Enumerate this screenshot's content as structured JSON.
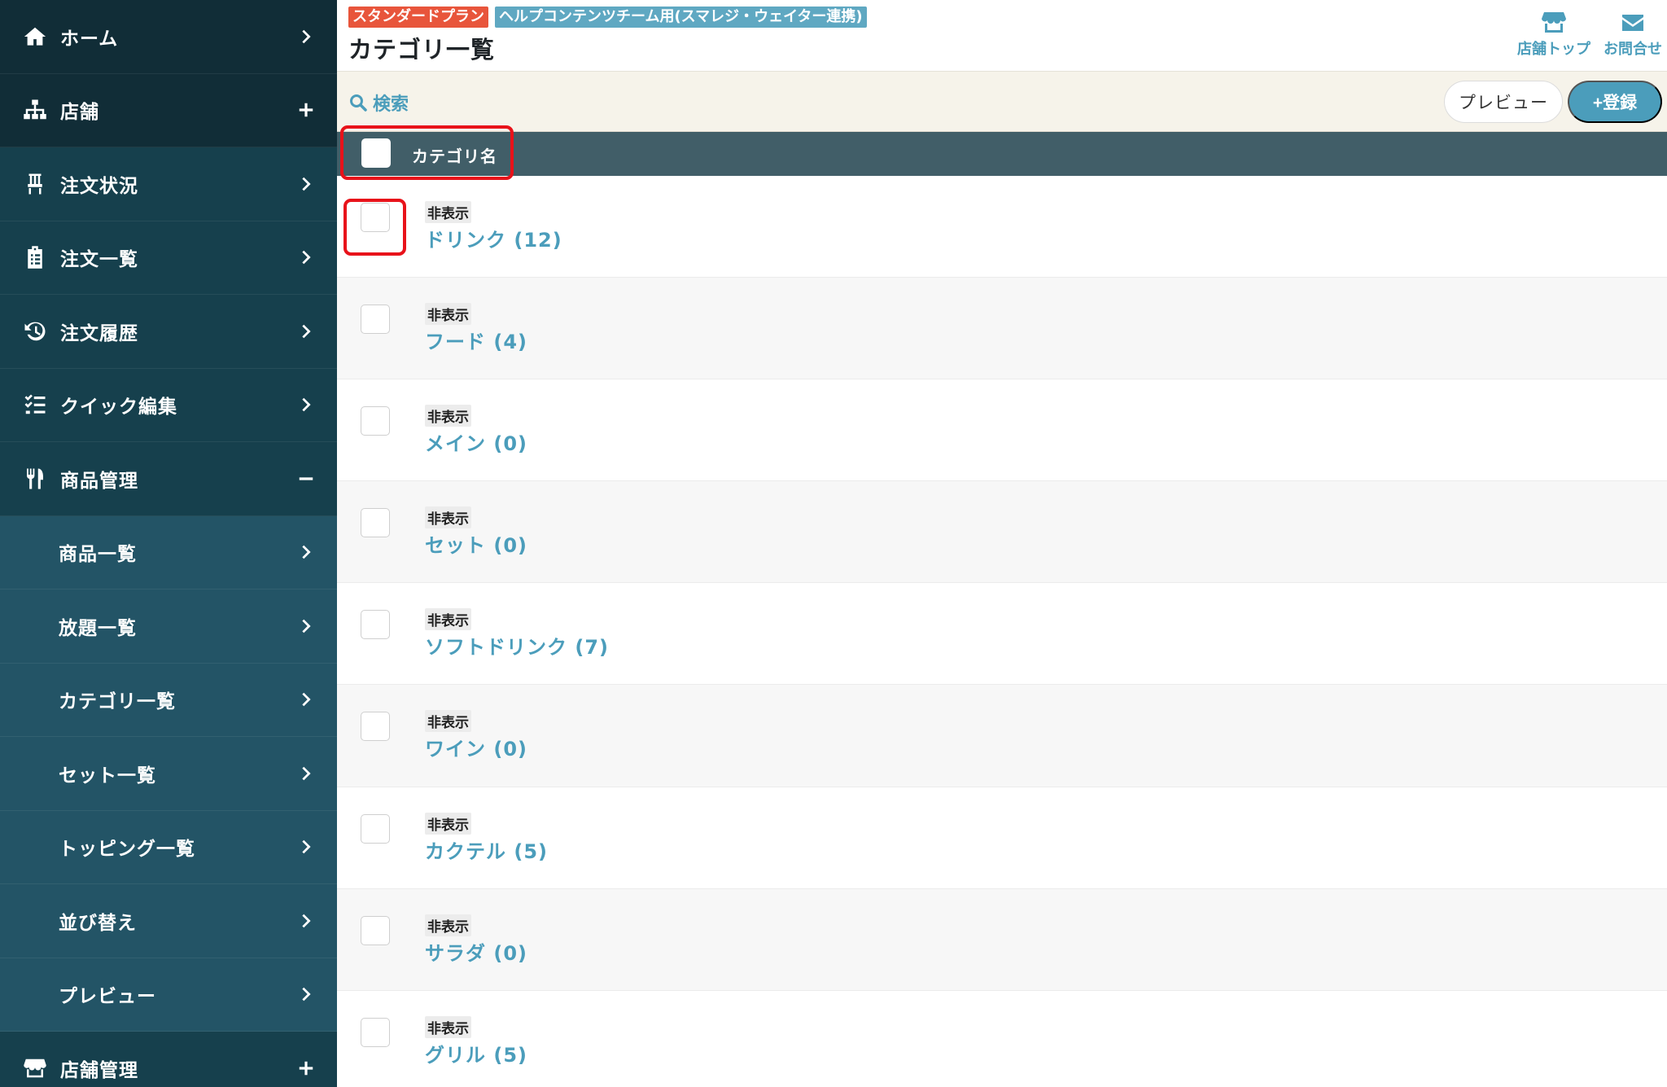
{
  "sidebar": {
    "items": [
      {
        "label": "ホーム",
        "icon": "home-icon",
        "trail": "chevron-right"
      },
      {
        "label": "店舗",
        "icon": "sitemap-icon",
        "trail": "plus"
      },
      {
        "label": "注文状況",
        "icon": "chair-icon",
        "trail": "chevron-right"
      },
      {
        "label": "注文一覧",
        "icon": "clipboard-icon",
        "trail": "chevron-right"
      },
      {
        "label": "注文履歴",
        "icon": "history-icon",
        "trail": "chevron-right"
      },
      {
        "label": "クイック編集",
        "icon": "checklist-icon",
        "trail": "chevron-right"
      },
      {
        "label": "商品管理",
        "icon": "utensils-icon",
        "trail": "minus"
      }
    ],
    "sub_items": [
      {
        "label": "商品一覧"
      },
      {
        "label": "放題一覧"
      },
      {
        "label": "カテゴリ一覧"
      },
      {
        "label": "セット一覧"
      },
      {
        "label": "トッピング一覧"
      },
      {
        "label": "並び替え"
      },
      {
        "label": "プレビュー"
      }
    ],
    "footer_item": {
      "label": "店舗管理",
      "icon": "store-icon",
      "trail": "plus"
    }
  },
  "header": {
    "plan_badge": "スタンダードプラン",
    "team_badge": "ヘルプコンテンツチーム用(スマレジ・ウェイター連携)",
    "title": "カテゴリ一覧",
    "actions": [
      {
        "label": "店舗トップ",
        "icon": "store-icon"
      },
      {
        "label": "お問合せ",
        "icon": "mail-icon"
      }
    ]
  },
  "toolbar": {
    "search_label": "検索",
    "preview_label": "プレビュー",
    "register_label": "+登録"
  },
  "table": {
    "column_header": "カテゴリ名",
    "rows": [
      {
        "status": "非表示",
        "name": "ドリンク (12)"
      },
      {
        "status": "非表示",
        "name": "フード (4)"
      },
      {
        "status": "非表示",
        "name": "メイン (0)"
      },
      {
        "status": "非表示",
        "name": "セット (0)"
      },
      {
        "status": "非表示",
        "name": "ソフトドリンク (7)"
      },
      {
        "status": "非表示",
        "name": "ワイン (0)"
      },
      {
        "status": "非表示",
        "name": "カクテル (5)"
      },
      {
        "status": "非表示",
        "name": "サラダ (0)"
      },
      {
        "status": "非表示",
        "name": "グリル (5)"
      }
    ]
  },
  "colors": {
    "sidebar_bg": "#13343f",
    "sidebar_sub_bg": "#235466",
    "accent": "#4b9dbb",
    "plan_badge": "#e8553b",
    "table_header": "#415e68",
    "highlight": "#e8121a"
  }
}
